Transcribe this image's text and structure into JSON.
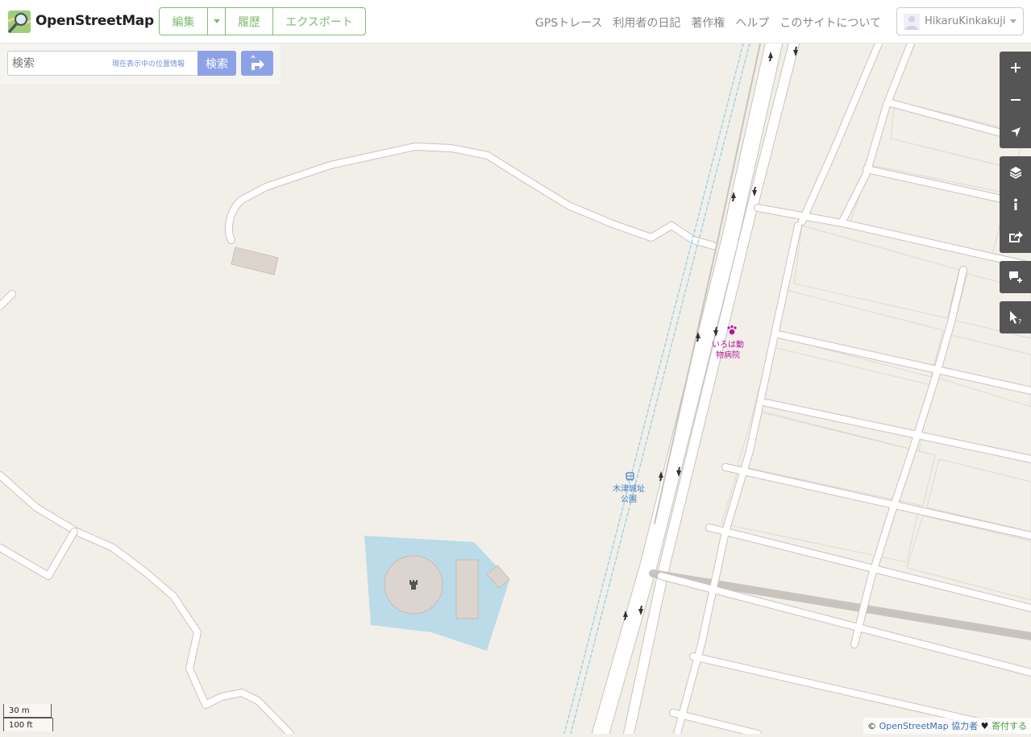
{
  "header": {
    "brand": "OpenStreetMap",
    "edit_label": "編集",
    "history_label": "履歴",
    "export_label": "エクスポート",
    "nav": [
      "GPSトレース",
      "利用者の日記",
      "著作権",
      "ヘルプ",
      "このサイトについて"
    ],
    "username": "HikaruKinkakuji"
  },
  "search": {
    "placeholder": "検索",
    "where_am_i": "現在表示中の位置情報",
    "button": "検索"
  },
  "map_controls": [
    "zoom-in",
    "zoom-out",
    "show-my-location",
    "layers",
    "map-key",
    "share",
    "add-note",
    "query-features"
  ],
  "poi": {
    "vet_name_line1": "いろは動",
    "vet_name_line2": "物病院",
    "bus_stop_line1": "木津城址",
    "bus_stop_line2": "公園"
  },
  "scale": {
    "metric": "30 m",
    "imperial": "100 ft"
  },
  "attribution": {
    "copyright": "©",
    "osm_link": "OpenStreetMap",
    "contributors": "協力者",
    "heart": "♥",
    "donate": "寄付する"
  },
  "colors": {
    "accent_green": "#7ebc6f",
    "search_blue": "#8da2e6",
    "map_bg": "#f2efe9",
    "water": "#bcdbe8",
    "building": "#dcd5cf",
    "poi_purple": "#b5149a",
    "bus_blue": "#3f7dc2"
  }
}
